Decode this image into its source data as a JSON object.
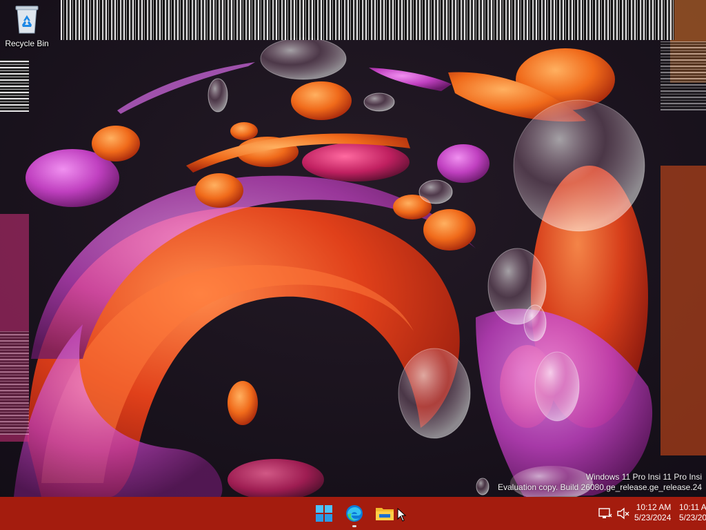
{
  "desktop": {
    "icons": [
      {
        "label": "Recycle Bin",
        "icon": "recycle-bin-icon"
      }
    ]
  },
  "watermark": {
    "line1": "Windows 11 Pro Insi 11 Pro Insi",
    "line2": "Evaluation copy. Build 26080.ge_release.ge_release.24"
  },
  "taskbar": {
    "color": "#a41c0e",
    "pinned": [
      {
        "name": "Start",
        "icon": "windows-start-icon"
      },
      {
        "name": "Microsoft Edge",
        "icon": "edge-icon"
      },
      {
        "name": "File Explorer",
        "icon": "file-explorer-icon"
      }
    ],
    "tray": {
      "icons": [
        "network-icon",
        "volume-muted-icon"
      ],
      "clocks": [
        {
          "time": "10:12 AM",
          "date": "5/23/2024"
        },
        {
          "time": "10:11 A",
          "date": "5/23/20"
        }
      ]
    }
  }
}
